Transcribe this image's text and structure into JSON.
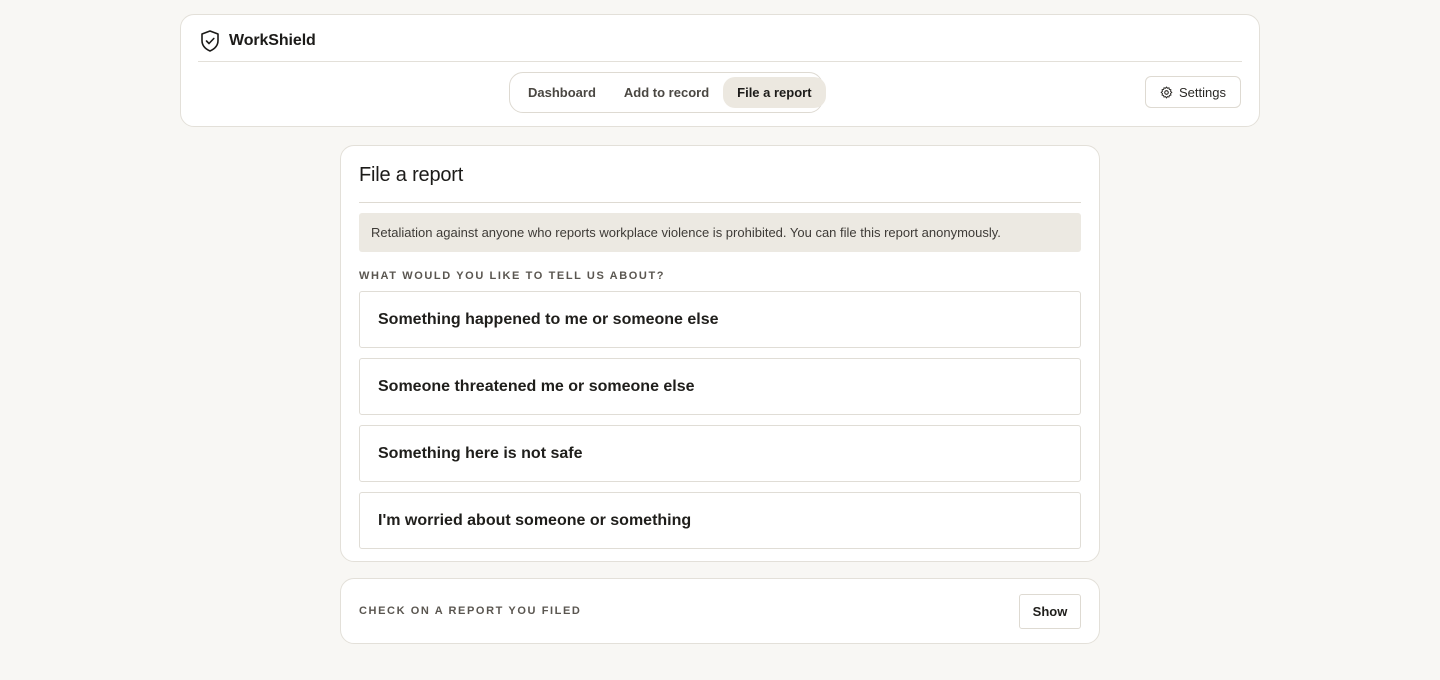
{
  "brand": {
    "name": "WorkShield",
    "icon": "shield-check-icon"
  },
  "nav": {
    "tabs": [
      {
        "label": "Dashboard",
        "active": false
      },
      {
        "label": "Add to record",
        "active": false
      },
      {
        "label": "File a report",
        "active": true
      }
    ]
  },
  "settings": {
    "label": "Settings",
    "icon": "gear-icon"
  },
  "report": {
    "title": "File a report",
    "notice": "Retaliation against anyone who reports workplace violence is prohibited. You can file this report anonymously.",
    "section_label": "WHAT WOULD YOU LIKE TO TELL US ABOUT?",
    "options": [
      {
        "label": "Something happened to me or someone else"
      },
      {
        "label": "Someone threatened me or someone else"
      },
      {
        "label": "Something here is not safe"
      },
      {
        "label": "I'm worried about someone or something"
      }
    ]
  },
  "check": {
    "label": "CHECK ON A REPORT YOU FILED",
    "button_label": "Show"
  },
  "colors": {
    "page_bg": "#f8f7f4",
    "card_bg": "#ffffff",
    "active_tab_bg": "#ece8e0",
    "notice_bg": "#ece9e2",
    "border": "#e3e0d9"
  }
}
